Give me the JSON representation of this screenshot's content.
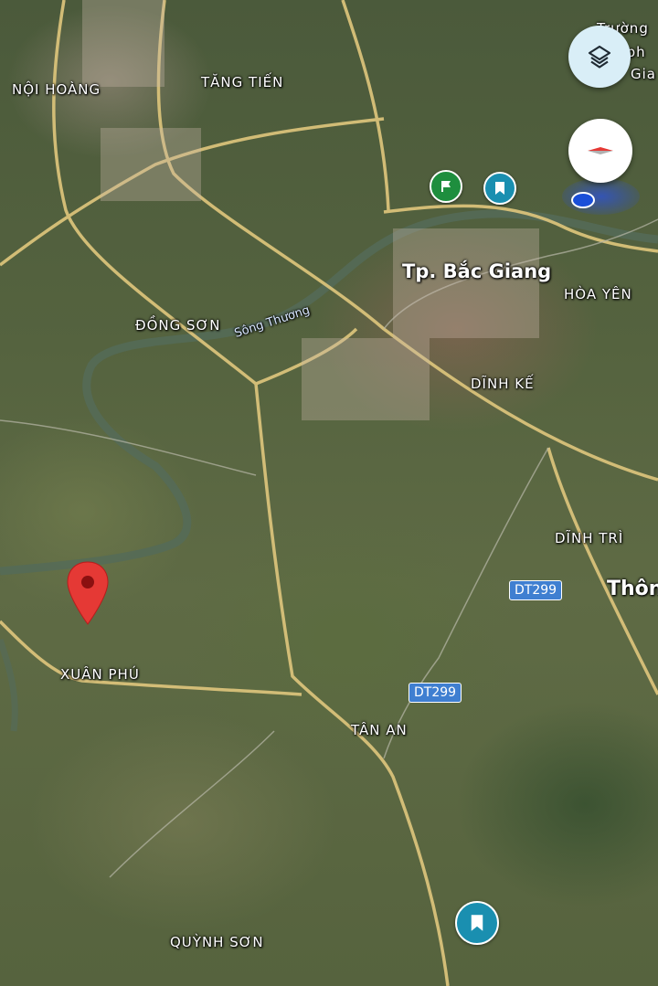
{
  "map": {
    "places": {
      "noi_hoang": "NỘI HOÀNG",
      "tang_tien": "TĂNG TIẾN",
      "bac_giang": "Tp. Bắc Giang",
      "hoa_yen": "HÒA YÊN",
      "dong_son": "ĐỒNG SƠN",
      "dinh_ke": "DĨNH KẾ",
      "dinh_tri": "DĨNH TRÌ",
      "thon": "Thôn",
      "xuan_phu": "XUÂN PHÚ",
      "tan_an": "TÂN AN",
      "quynh_son": "QUỲNH SƠN",
      "truong_top": "Trường",
      "truong_mid": "y ph",
      "truong_bot": "Gia"
    },
    "river": "Sông Thương",
    "road_shields": {
      "dt299_a": "DT299",
      "dt299_b": "DT299"
    }
  },
  "controls": {
    "layers_icon": "layers-icon",
    "compass_icon": "compass-icon"
  },
  "markers": {
    "selected_pin_color": "#e53935",
    "my_location_color": "#1a4fd8",
    "flag_poi_color": "#1e8e3e",
    "saved_poi_color": "#1a8fb0"
  }
}
